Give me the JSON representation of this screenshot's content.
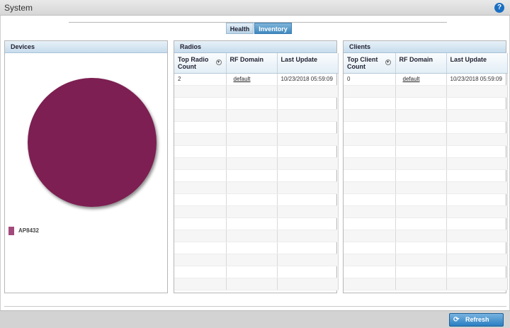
{
  "header": {
    "title": "System",
    "help_icon": "?"
  },
  "tabs": [
    {
      "label": "Health",
      "active": false
    },
    {
      "label": "Inventory",
      "active": true
    }
  ],
  "devices": {
    "title": "Devices",
    "legend": [
      {
        "label": "AP8432",
        "color": "#7d1f52"
      }
    ]
  },
  "radios": {
    "title": "Radios",
    "columns": [
      "Top Radio Count",
      "RF Domain",
      "Last Update"
    ],
    "rows": [
      [
        "2",
        "default",
        "10/23/2018 05:59:09"
      ]
    ]
  },
  "clients": {
    "title": "Clients",
    "columns": [
      "Top Client Count",
      "RF Domain",
      "Last Update"
    ],
    "rows": [
      [
        "0",
        "default",
        "10/23/2018 05:59:09"
      ]
    ]
  },
  "footer": {
    "refresh_label": "Refresh"
  },
  "colors": {
    "accent": "#2a7ec1",
    "pie": "#7d1f52"
  }
}
